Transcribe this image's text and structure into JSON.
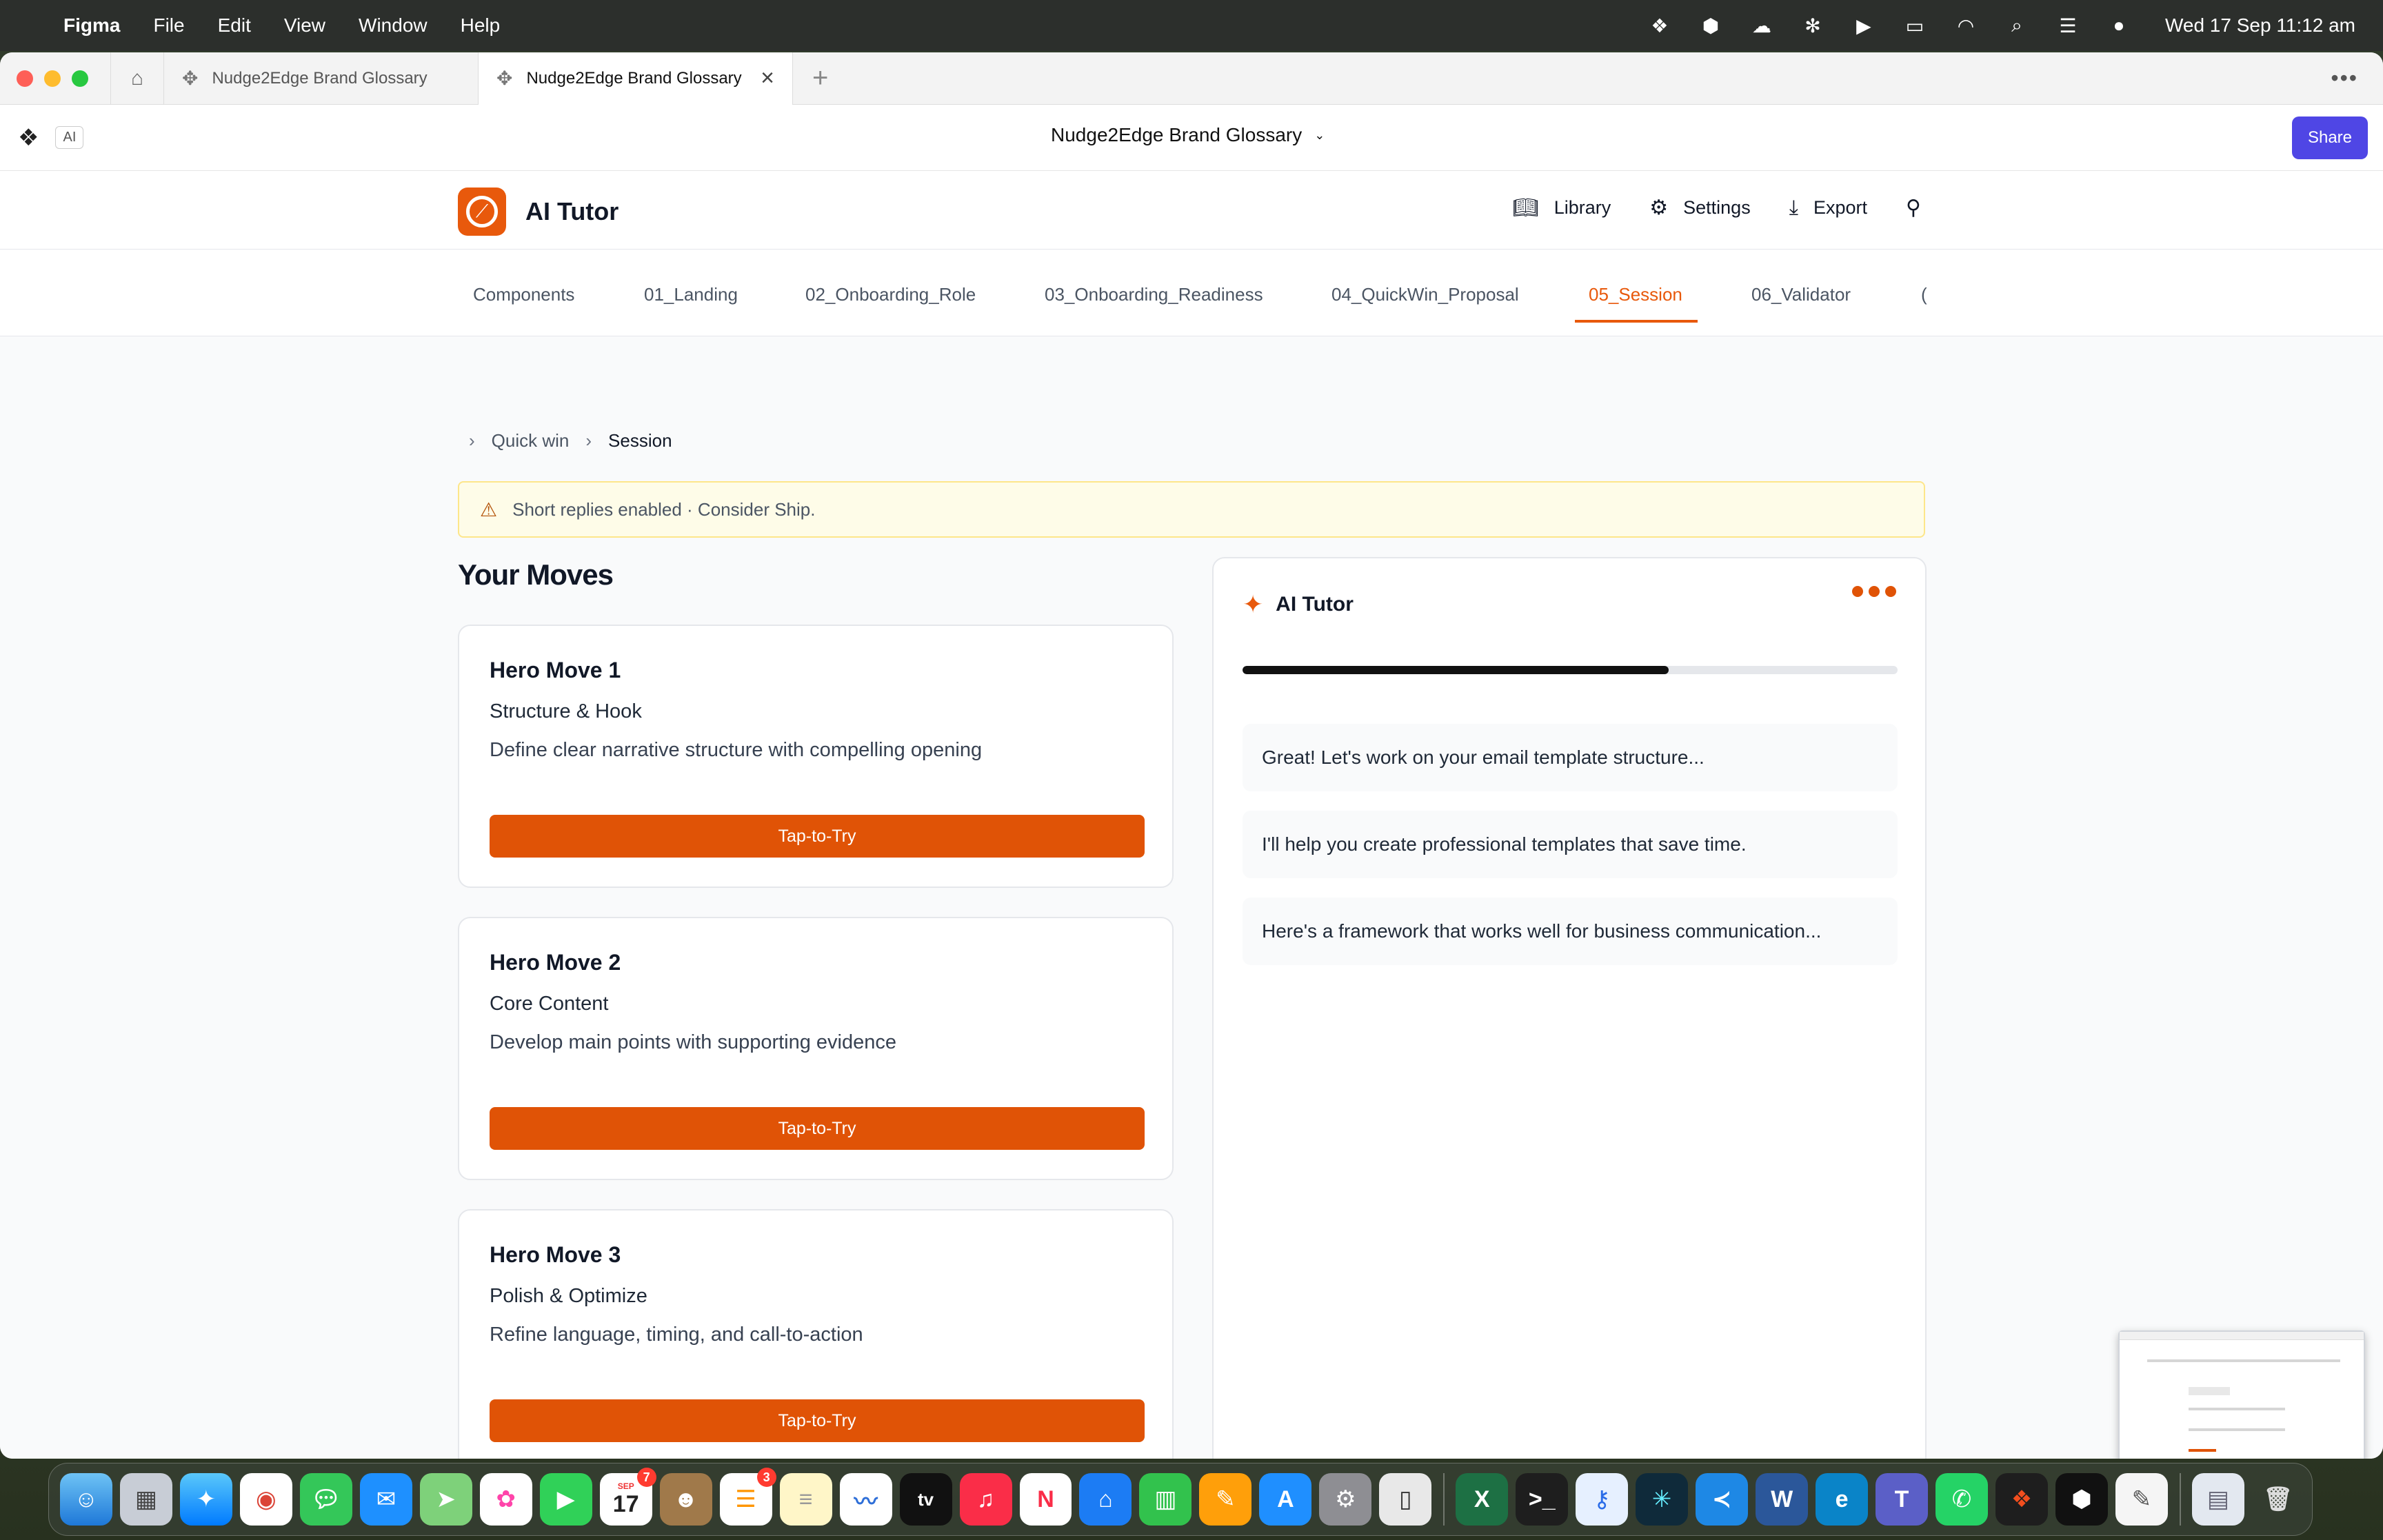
{
  "menubar": {
    "app": "Figma",
    "items": [
      "File",
      "Edit",
      "View",
      "Window",
      "Help"
    ],
    "clock": "Wed 17 Sep  11:12 am"
  },
  "browser": {
    "tabs": [
      {
        "label": "Nudge2Edge Brand Glossary"
      },
      {
        "label": "Nudge2Edge Brand Glossary"
      }
    ]
  },
  "toolbar": {
    "ai_chip": "AI",
    "file_title": "Nudge2Edge Brand Glossary",
    "share_label": "Share"
  },
  "app": {
    "name": "AI Tutor",
    "nav": {
      "library": "Library",
      "settings": "Settings",
      "export": "Export"
    }
  },
  "page_tabs": [
    "Components",
    "01_Landing",
    "02_Onboarding_Role",
    "03_Onboarding_Readiness",
    "04_QuickWin_Proposal",
    "05_Session",
    "06_Validator",
    "("
  ],
  "breadcrumb": {
    "parent": "Quick win",
    "current": "Session"
  },
  "alert": {
    "text": "Short replies enabled · Consider Ship."
  },
  "moves": {
    "title": "Your Moves",
    "cards": [
      {
        "title": "Hero Move 1",
        "subtitle": "Structure & Hook",
        "desc": "Define clear narrative structure with compelling opening",
        "cta": "Tap-to-Try"
      },
      {
        "title": "Hero Move 2",
        "subtitle": "Core Content",
        "desc": "Develop main points with supporting evidence",
        "cta": "Tap-to-Try"
      },
      {
        "title": "Hero Move 3",
        "subtitle": "Polish & Optimize",
        "desc": "Refine language, timing, and call-to-action",
        "cta": "Tap-to-Try"
      }
    ]
  },
  "tutor": {
    "title": "AI Tutor",
    "progress": 0.65,
    "messages": [
      "Great! Let's work on your email template structure...",
      "I'll help you create professional templates that save time.",
      "Here's a framework that works well for business communication..."
    ]
  },
  "dock": {
    "calendar_month": "SEP",
    "calendar_day": "17",
    "calendar_badge": "7",
    "reminders_badge": "3",
    "tv_label": "tv"
  },
  "colors": {
    "accent": "#e05306",
    "share": "#4f46e5",
    "alert_bg": "#fefce8"
  }
}
